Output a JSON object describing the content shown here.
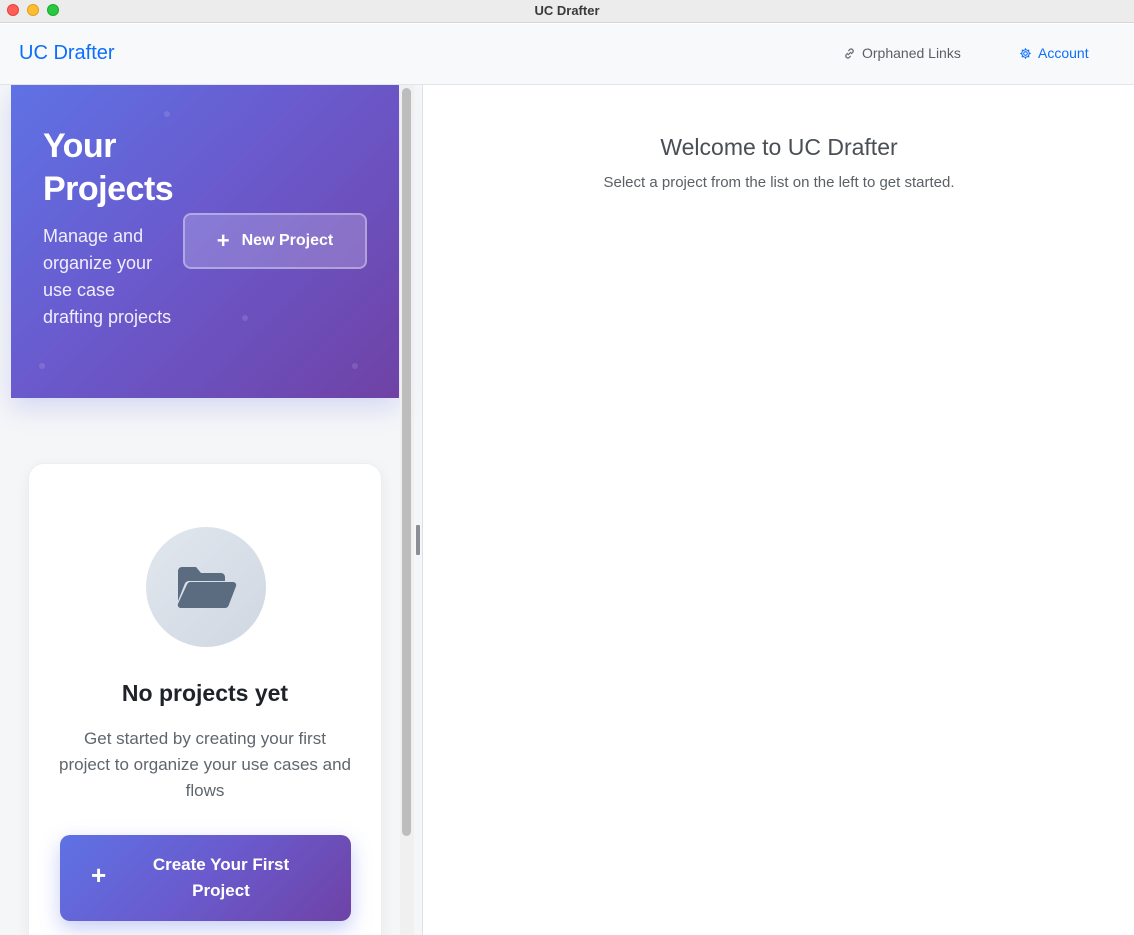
{
  "window": {
    "title": "UC Drafter"
  },
  "navbar": {
    "brand": "UC Drafter",
    "orphaned_links": {
      "label": "Orphaned Links",
      "icon": "link-icon"
    },
    "account": {
      "label": "Account",
      "icon": "gear-icon"
    }
  },
  "sidebar": {
    "hero": {
      "title": "Your Projects",
      "subtitle": "Manage and organize your use case drafting projects",
      "new_project_label": "New Project"
    },
    "empty_state": {
      "icon": "folder-open-icon",
      "title": "No projects yet",
      "description": "Get started by creating your first project to organize your use cases and flows",
      "cta_label": "Create Your First Project"
    }
  },
  "main": {
    "welcome_title": "Welcome to UC Drafter",
    "welcome_subtitle": "Select a project from the list on the left to get started."
  },
  "colors": {
    "accent": "#0d6efd",
    "gradient_start": "#5e72e4",
    "gradient_end": "#6f42a5"
  }
}
